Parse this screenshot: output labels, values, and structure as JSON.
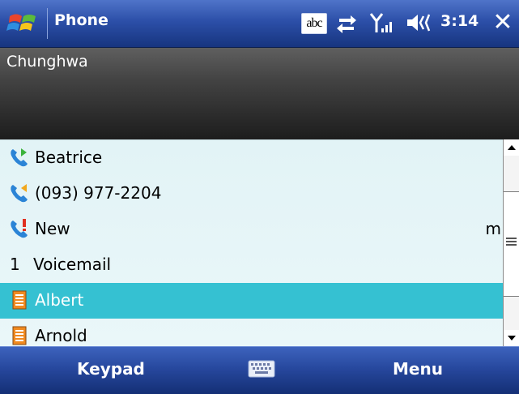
{
  "titlebar": {
    "title": "Phone",
    "input_mode": "abc",
    "time": "3:14",
    "close": "✕",
    "icons": [
      "windows-start-icon",
      "input-method-icon",
      "connectivity-icon",
      "signal-icon",
      "volume-icon",
      "close-icon"
    ]
  },
  "carrier": {
    "name": "Chunghwa"
  },
  "list": {
    "items": [
      {
        "label": "Beatrice",
        "icon": "outgoing-call-icon"
      },
      {
        "label": "(093) 977-2204",
        "icon": "incoming-call-icon"
      },
      {
        "label": "New",
        "icon": "missed-call-icon",
        "trail": "m"
      },
      {
        "number": "1",
        "label": "Voicemail"
      },
      {
        "label": "Albert",
        "icon": "contact-card-icon",
        "selected": true
      },
      {
        "label": "Arnold",
        "icon": "contact-card-icon"
      }
    ]
  },
  "softkeys": {
    "left": "Keypad",
    "right": "Menu",
    "center_icon": "keyboard-icon"
  },
  "colors": {
    "titlebar": "#2c4fa8",
    "list_bg": "#e6f5f8",
    "selection": "#35c1d2",
    "softbar": "#27489e"
  }
}
